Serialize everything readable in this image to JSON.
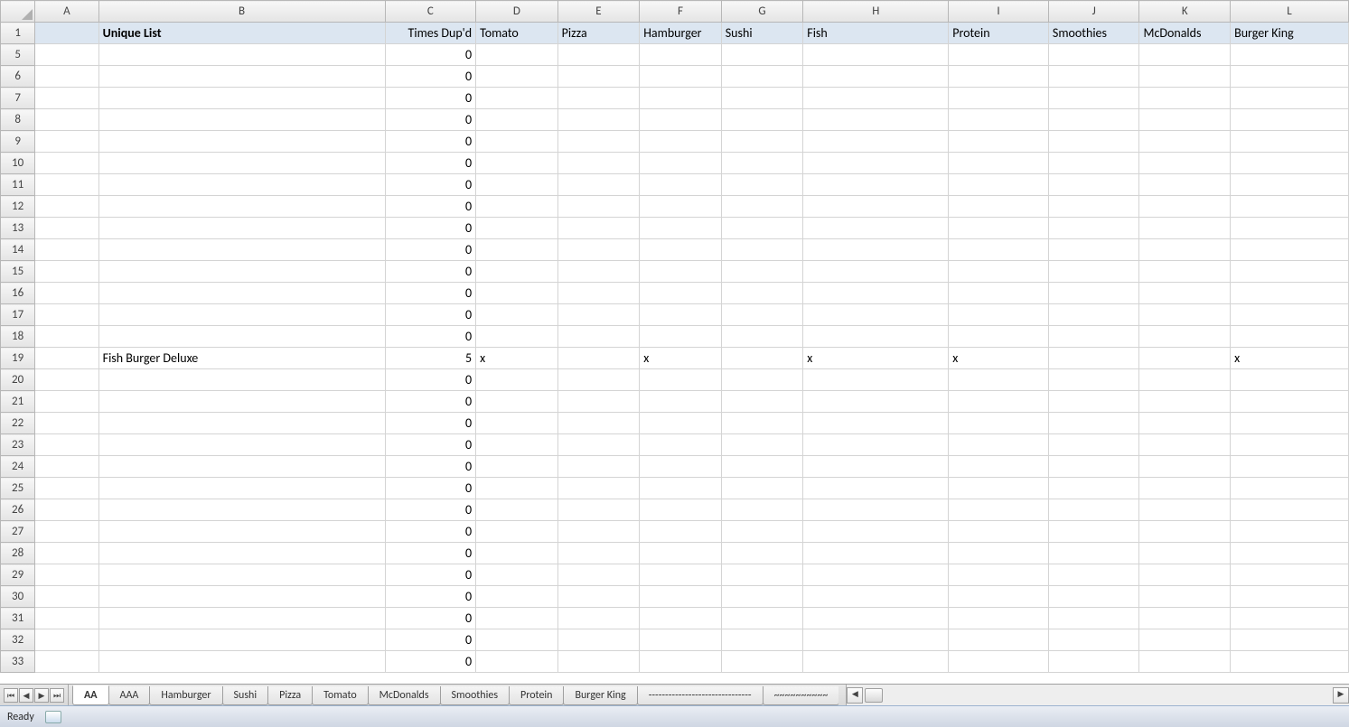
{
  "columns": [
    "A",
    "B",
    "C",
    "D",
    "E",
    "F",
    "G",
    "H",
    "I",
    "J",
    "K",
    "L"
  ],
  "header_row": {
    "A": "",
    "B": "Unique List",
    "C": "Times Dup'd",
    "D": "Tomato",
    "E": "Pizza",
    "F": "Hamburger",
    "G": "Sushi",
    "H": "Fish",
    "I": "Protein",
    "J": "Smoothies",
    "K": "McDonalds",
    "L": "Burger King"
  },
  "row_numbers": [
    5,
    6,
    7,
    8,
    9,
    10,
    11,
    12,
    13,
    14,
    15,
    16,
    17,
    18,
    19,
    20,
    21,
    22,
    23,
    24,
    25,
    26,
    27,
    28,
    29,
    30,
    31,
    32,
    33
  ],
  "rows": {
    "5": {
      "C": "0"
    },
    "6": {
      "C": "0"
    },
    "7": {
      "C": "0"
    },
    "8": {
      "C": "0"
    },
    "9": {
      "C": "0"
    },
    "10": {
      "C": "0"
    },
    "11": {
      "C": "0"
    },
    "12": {
      "C": "0"
    },
    "13": {
      "C": "0"
    },
    "14": {
      "C": "0"
    },
    "15": {
      "C": "0"
    },
    "16": {
      "C": "0"
    },
    "17": {
      "C": "0"
    },
    "18": {
      "C": "0"
    },
    "19": {
      "B": "Fish Burger Deluxe",
      "C": "5",
      "D": "x",
      "F": "x",
      "H": "x",
      "I": "x",
      "L": "x"
    },
    "20": {
      "C": "0"
    },
    "21": {
      "C": "0"
    },
    "22": {
      "C": "0"
    },
    "23": {
      "C": "0"
    },
    "24": {
      "C": "0"
    },
    "25": {
      "C": "0"
    },
    "26": {
      "C": "0"
    },
    "27": {
      "C": "0"
    },
    "28": {
      "C": "0"
    },
    "29": {
      "C": "0"
    },
    "30": {
      "C": "0"
    },
    "31": {
      "C": "0"
    },
    "32": {
      "C": "0"
    },
    "33": {
      "C": "0"
    }
  },
  "sheet_tabs": [
    "AA",
    "AAA",
    "Hamburger",
    "Sushi",
    "Pizza",
    "Tomato",
    "McDonalds",
    "Smoothies",
    "Protein",
    "Burger King",
    "-------------------------------",
    "~~~~~~~~~~"
  ],
  "active_tab": "AA",
  "status": {
    "text": "Ready"
  }
}
